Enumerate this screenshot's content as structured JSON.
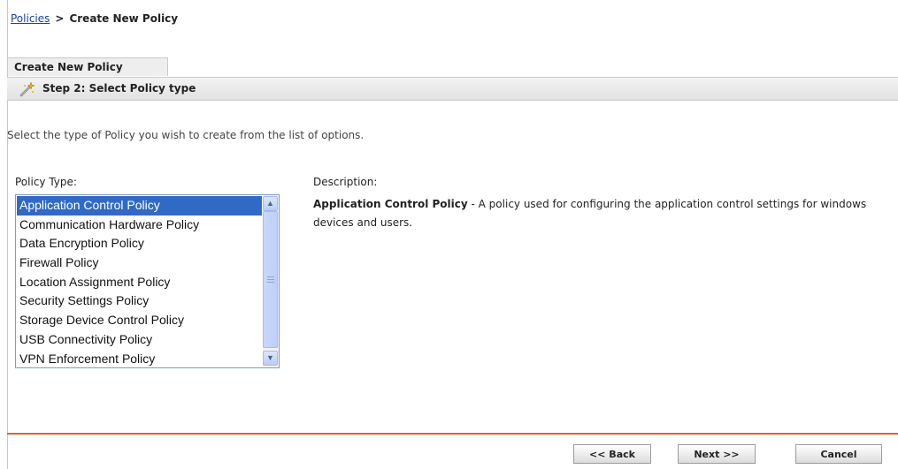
{
  "breadcrumb": {
    "link": "Policies",
    "separator": ">",
    "current": "Create New Policy"
  },
  "tab": {
    "label": "Create New Policy"
  },
  "step": {
    "title": "Step 2: Select Policy type",
    "icon": "wizard-wand-icon"
  },
  "instructions": "Select the type of Policy you wish to create from the list of options.",
  "policy_type": {
    "label": "Policy Type:",
    "items": [
      "Application Control Policy",
      "Communication Hardware Policy",
      "Data Encryption Policy",
      "Firewall Policy",
      "Location Assignment Policy",
      "Security Settings Policy",
      "Storage Device Control Policy",
      "USB Connectivity Policy",
      "VPN Enforcement Policy"
    ],
    "selected": "Application Control Policy"
  },
  "description": {
    "label": "Description:",
    "title": "Application Control Policy",
    "text": " - A policy used for configuring the application control settings for windows devices and users."
  },
  "buttons": {
    "back": "<< Back",
    "next": "Next >>",
    "cancel": "Cancel"
  },
  "colors": {
    "selection": "#316ac5",
    "footer_rule": "#e0642b",
    "link": "#1a3fa8"
  }
}
